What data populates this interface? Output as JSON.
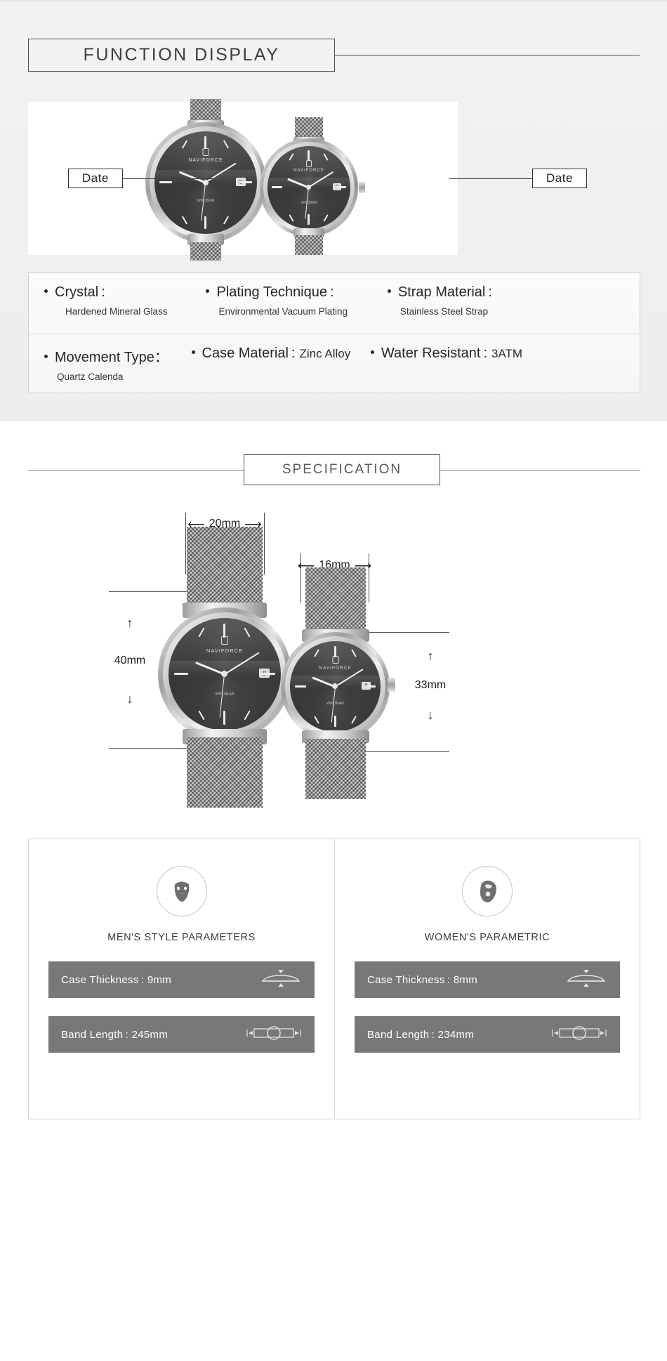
{
  "section1": {
    "title": "FUNCTION  DISPLAY",
    "callout_left": "Date",
    "callout_right": "Date",
    "specs": [
      {
        "label": "Crystal :",
        "value": "Hardened Mineral Glass",
        "inline": ""
      },
      {
        "label": "Plating Technique :",
        "value": "Environmental Vacuum Plating",
        "inline": ""
      },
      {
        "label": "Strap Material :",
        "value": "Stainless Steel Strap",
        "inline": ""
      },
      {
        "label": "Movement Type：",
        "value": "Quartz Calenda",
        "inline": ""
      },
      {
        "label": "Case Material :",
        "value": "",
        "inline": "Zinc Alloy"
      },
      {
        "label": "Water Resistant :",
        "value": "",
        "inline": "3ATM"
      }
    ]
  },
  "section2": {
    "title": "SPECIFICATION",
    "dimensions": {
      "mens_band_width": "20mm",
      "womens_band_width": "16mm",
      "mens_case_diameter": "40mm",
      "womens_case_diameter": "33mm"
    },
    "watch_dial": {
      "brand": "NAVIFORCE",
      "water_resist_print": "WR 3BAR",
      "date_window": "8"
    },
    "cards": [
      {
        "icon": "beard-man-icon",
        "title": "MEN'S STYLE PARAMETERS",
        "rows": [
          {
            "label": "Case Thickness : 9mm",
            "icon": "case-thickness-icon"
          },
          {
            "label": "Band Length : 245mm",
            "icon": "band-length-icon"
          }
        ]
      },
      {
        "icon": "woman-hair-icon",
        "title": "WOMEN'S PARAMETRIC",
        "rows": [
          {
            "label": "Case Thickness : 8mm",
            "icon": "case-thickness-icon"
          },
          {
            "label": "Band Length : 234mm",
            "icon": "band-length-icon"
          }
        ]
      }
    ]
  },
  "colors": {
    "page_bg": "#ffffff",
    "panel_bg": "#f1f1f0",
    "line": "#4a4a4a",
    "bar_bg": "#787878",
    "text": "#2b2b2b"
  }
}
